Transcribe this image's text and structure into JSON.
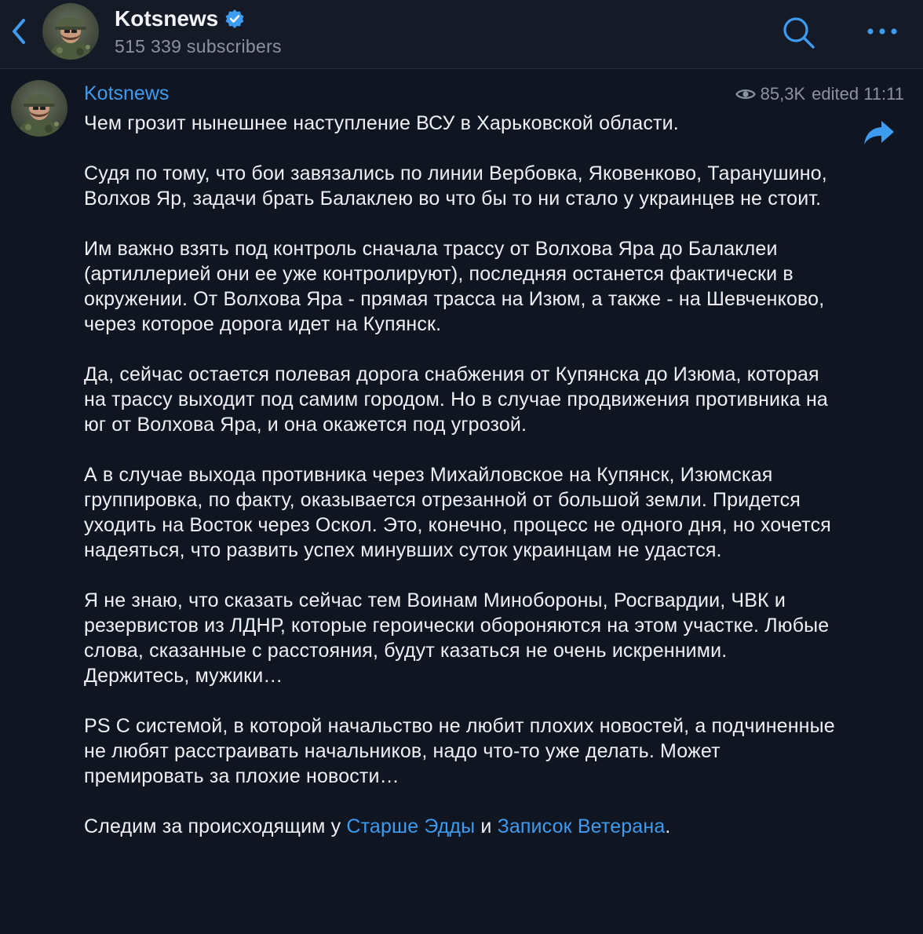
{
  "header": {
    "channel_name": "Kotsnews",
    "subscribers": "515 339 subscribers"
  },
  "post": {
    "author": "Kotsnews",
    "views": "85,3K",
    "edited": "edited 11:11",
    "paragraphs": [
      "Чем грозит нынешнее наступление ВСУ в Харьковской области.",
      "Судя по тому, что бои завязались по линии Вербовка, Яковенково, Таранушино, Волхов Яр, задачи брать Балаклею во что бы то ни стало у украинцев не стоит.",
      "Им важно взять под контроль сначала трассу от Волхова Яра до Балаклеи (артиллерией они ее уже контролируют), последняя останется фактически в окружении. От Волхова Яра - прямая трасса на Изюм, а также - на Шевченково, через которое дорога идет на Купянск.",
      "Да, сейчас остается полевая дорога снабжения от Купянска до Изюма, которая на трассу выходит под самим городом. Но в случае продвижения противника на юг от Волхова Яра, и она окажется под угрозой.",
      "А в случае выхода противника через Михайловское на Купянск, Изюмская группировка, по факту, оказывается отрезанной от большой земли. Придется уходить на Восток через Оскол. Это, конечно, процесс не одного дня, но хочется надеяться, что развить успех минувших суток украинцам не удастся.",
      "Я не знаю, что сказать сейчас тем Воинам Минобороны, Росгвардии, ЧВК и резервистов из ЛДНР, которые героически обороняются на этом участке. Любые слова, сказанные с расстояния, будут казаться не очень искренними. Держитесь, мужики…",
      "PS С системой, в которой начальство не любит плохих новостей, а подчиненные не любят расстраивать начальников, надо что-то уже делать. Может премировать за плохие новости…"
    ],
    "final": {
      "prefix": "Следим за происходящим у ",
      "link1": "Старше Эдды",
      "middle": " и ",
      "link2": "Записок Ветерана",
      "suffix": "."
    }
  },
  "colors": {
    "background": "#0f1521",
    "header_background": "#141b27",
    "accent": "#3d9bf0",
    "muted_text": "#8a93a3",
    "text": "#eef0f4"
  },
  "icons": {
    "back": "chevron-left-icon",
    "verified": "verified-badge-icon",
    "search": "search-icon",
    "more": "more-dots-icon",
    "views": "eye-icon",
    "share": "share-arrow-icon"
  }
}
